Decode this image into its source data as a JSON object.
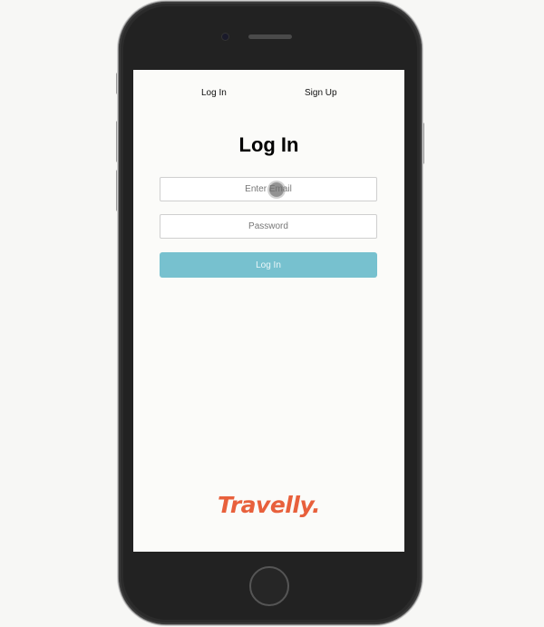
{
  "nav": {
    "login_label": "Log In",
    "signup_label": "Sign Up"
  },
  "main": {
    "title": "Log In",
    "email_placeholder": "Enter Email",
    "password_placeholder": "Password",
    "submit_label": "Log In"
  },
  "brand": {
    "logo_text": "Travelly.",
    "logo_color": "#e8603c",
    "button_color": "#77c1cf"
  }
}
